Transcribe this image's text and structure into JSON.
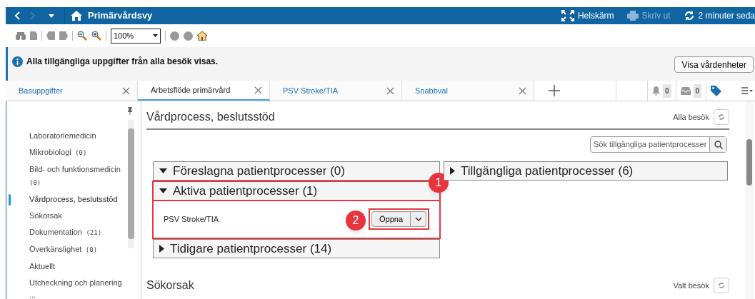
{
  "title_bar": {
    "title": "Primärvårdsvy",
    "actions": [
      {
        "kind": "fullscreen",
        "label": "Helskärm",
        "disabled": false
      },
      {
        "kind": "print",
        "label": "Skriv ut",
        "disabled": true
      },
      {
        "kind": "refresh",
        "label": "2 minuter seda",
        "disabled": false
      }
    ]
  },
  "toolbar": {
    "zoom": "100%"
  },
  "info_bar": {
    "message": "Alla tillgängliga uppgifter från alla besök visas.",
    "button": "Visa vårdenheter"
  },
  "tabs": [
    {
      "label": "Basuppgifter",
      "selected": false
    },
    {
      "label": "Arbetsflöde primärvård",
      "selected": true
    },
    {
      "label": "PSV Stroke/TIA",
      "selected": false
    },
    {
      "label": "Snabbval",
      "selected": false
    }
  ],
  "tab_badges": [
    {
      "kind": "bell",
      "count": "0"
    },
    {
      "kind": "inbox",
      "count": "0"
    }
  ],
  "sidebar": {
    "items": [
      {
        "label": "Laboratoriemedicin",
        "selected": false
      },
      {
        "label": "Mikrobiologi",
        "count": "(0)",
        "selected": false
      },
      {
        "label": "Bild- och funktionsmedicin",
        "count": "(0)",
        "selected": false
      },
      {
        "label": "Vårdprocess, beslutsstöd",
        "selected": true
      },
      {
        "label": "Sökorsak",
        "selected": false
      },
      {
        "label": "Dokumentation",
        "count": "(21)",
        "selected": false
      },
      {
        "label": "Överkänslighet",
        "count": "(0)",
        "selected": false
      },
      {
        "label": "Aktuellt",
        "selected": false
      },
      {
        "label": "Utcheckning och planering ...",
        "selected": false
      }
    ]
  },
  "sections": [
    {
      "title": "Vårdprocess, beslutsstöd",
      "scope": "Alla besök",
      "search": {
        "placeholder": "Sök tillgängliga patientprocesser"
      },
      "left_panels": [
        {
          "title": "Föreslagna patientprocesser (0)",
          "expanded": true
        },
        {
          "title": "Aktiva patientprocesser (1)",
          "expanded": true,
          "callout": "1",
          "rows": [
            {
              "name": "PSV Stroke/TIA",
              "button": "Öppna",
              "callout": "2"
            }
          ]
        },
        {
          "title": "Tidigare patientprocesser (14)",
          "expanded": false
        }
      ],
      "right_panels": [
        {
          "title": "Tillgängliga patientprocesser (6)",
          "expanded": false
        }
      ]
    },
    {
      "title": "Sökorsak",
      "scope": "Valt besök"
    }
  ]
}
